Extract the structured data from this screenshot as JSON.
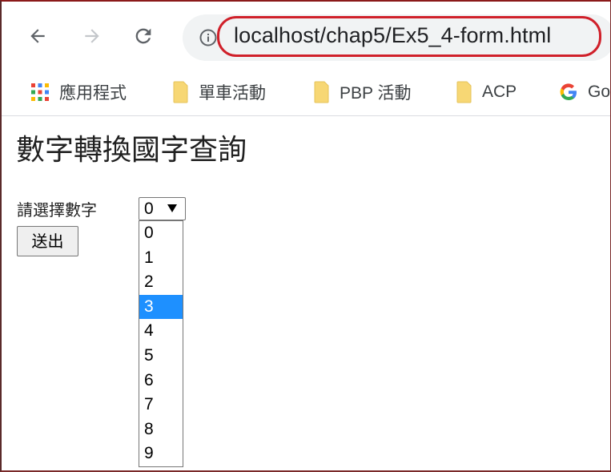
{
  "browser": {
    "url": "localhost/chap5/Ex5_4-form.html",
    "bookmarks": [
      {
        "label": "應用程式",
        "icon": "apps-grid-icon"
      },
      {
        "label": "單車活動",
        "icon": "folder-icon"
      },
      {
        "label": "PBP 活動",
        "icon": "folder-icon"
      },
      {
        "label": "ACP",
        "icon": "folder-icon"
      },
      {
        "label": "Go",
        "icon": "google-icon"
      }
    ],
    "colors": {
      "url_highlight": "#d0202a",
      "folder": "#f7d774",
      "omnibox": "#f1f3f4"
    }
  },
  "page": {
    "title": "數字轉換國字查詢",
    "form": {
      "label": "請選擇數字",
      "selected_value": "0",
      "options": [
        "0",
        "1",
        "2",
        "3",
        "4",
        "5",
        "6",
        "7",
        "8",
        "9"
      ],
      "highlighted_option": "3",
      "submit_label": "送出"
    }
  }
}
